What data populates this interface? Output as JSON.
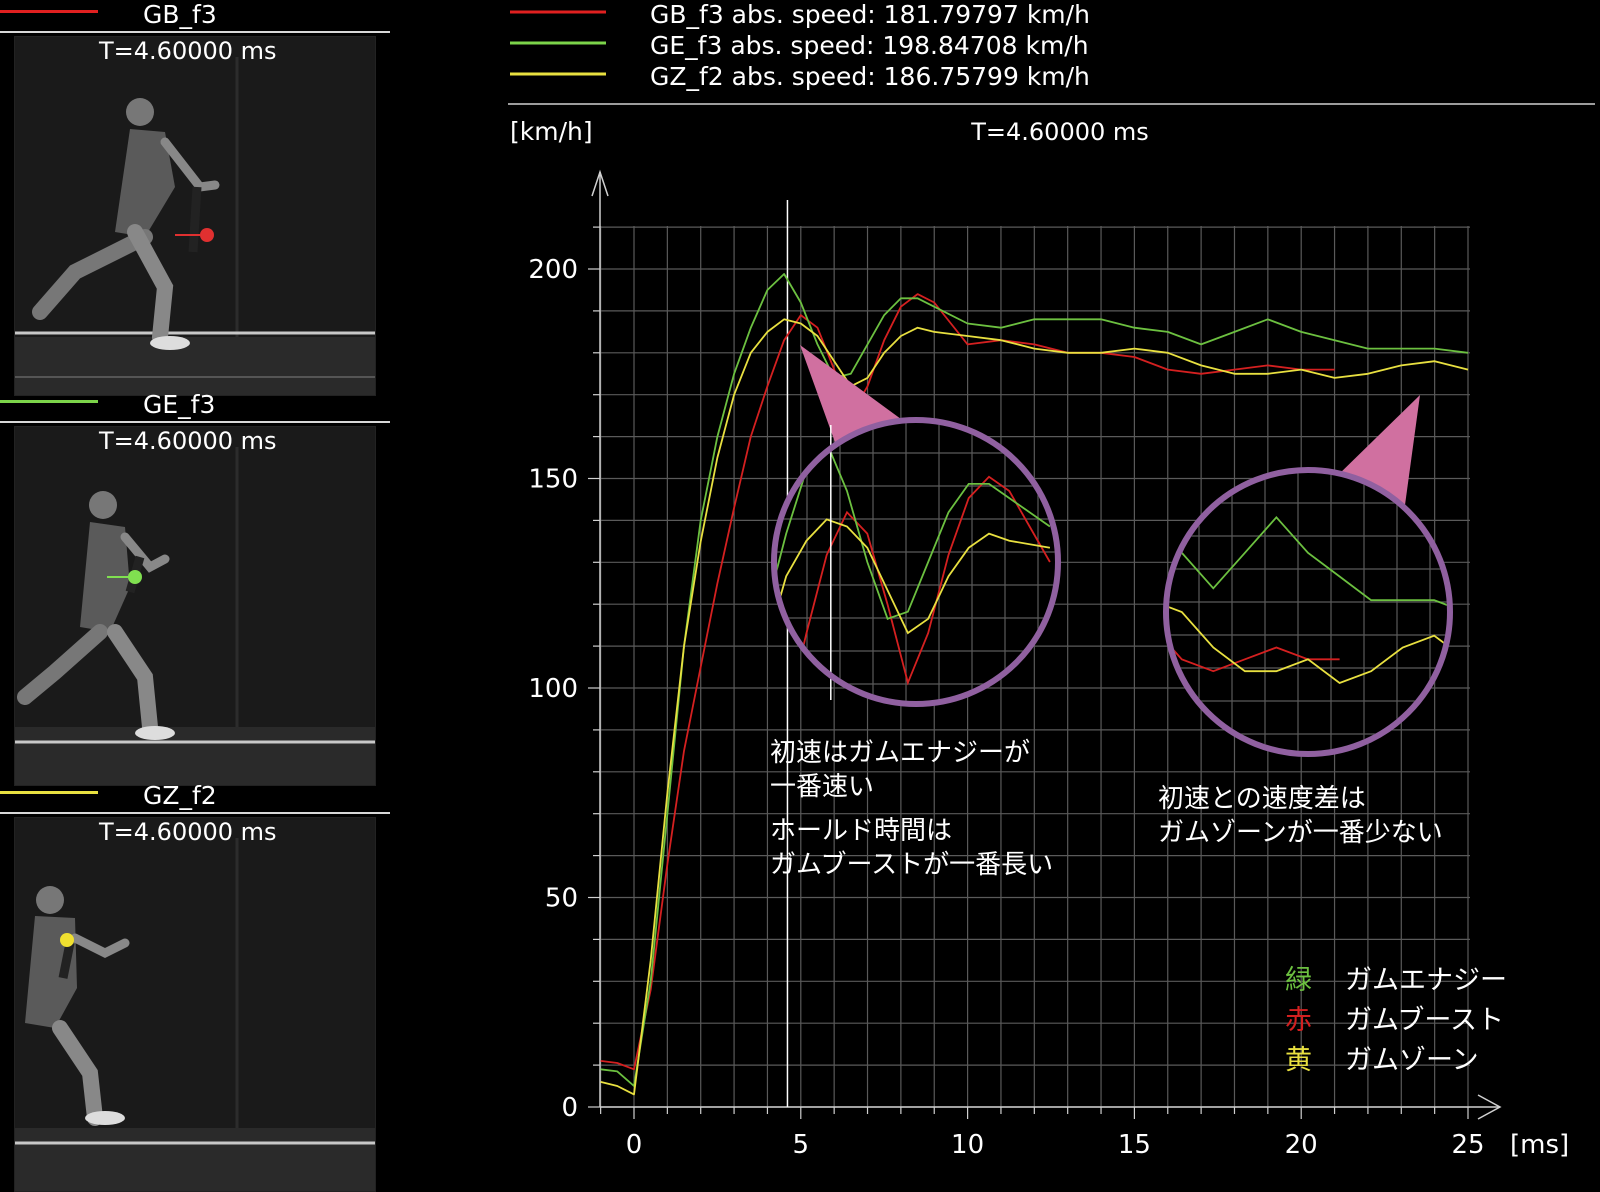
{
  "panels": [
    {
      "label": "GB_f3",
      "color": "#e02020",
      "time": "T=4.60000 ms",
      "ball_color": "#e03030"
    },
    {
      "label": "GE_f3",
      "color": "#7cd44a",
      "time": "T=4.60000 ms",
      "ball_color": "#80e050"
    },
    {
      "label": "GZ_f2",
      "color": "#e8e040",
      "time": "T=4.60000 ms",
      "ball_color": "#f0e030"
    }
  ],
  "header_legend": [
    {
      "text": "GB_f3 abs. speed: 181.79797 km/h",
      "color": "#e02020"
    },
    {
      "text": "GE_f3 abs. speed: 198.84708 km/h",
      "color": "#7cd44a"
    },
    {
      "text": "GZ_f2 abs. speed: 186.75799 km/h",
      "color": "#e8e040"
    }
  ],
  "chart_data": {
    "type": "line",
    "ylabel": "[km/h]",
    "xlabel": "[ms]",
    "time_label": "T=4.60000 ms",
    "cursor_x": 4.6,
    "xlim": [
      -1,
      25
    ],
    "ylim": [
      0,
      215
    ],
    "xticks": [
      0,
      5,
      10,
      15,
      20,
      25
    ],
    "yticks": [
      0,
      50,
      100,
      150,
      200
    ],
    "grid": true,
    "series": [
      {
        "name": "GB_f3",
        "color": "#d42020",
        "x": [
          -1,
          -0.5,
          0,
          0.5,
          1,
          1.5,
          2,
          2.5,
          3,
          3.5,
          4,
          4.5,
          5,
          5.5,
          6,
          6.5,
          7,
          7.5,
          8,
          8.5,
          9,
          9.5,
          10,
          11,
          12,
          13,
          14,
          15,
          16,
          17,
          18,
          19,
          20,
          20.5,
          21
        ],
        "y": [
          11,
          10.5,
          9,
          28,
          58,
          85,
          105,
          125,
          143,
          160,
          172,
          183,
          189,
          186,
          176,
          165,
          172,
          183,
          191,
          194,
          192,
          187,
          182,
          183,
          182,
          180,
          180,
          179,
          176,
          175,
          176,
          177,
          176,
          176,
          176
        ]
      },
      {
        "name": "GE_f3",
        "color": "#6cc040",
        "x": [
          -1,
          -0.5,
          0,
          0.5,
          1,
          1.5,
          2,
          2.5,
          3,
          3.5,
          4,
          4.5,
          5,
          5.5,
          6,
          6.5,
          7,
          7.5,
          8,
          8.5,
          9,
          10,
          11,
          12,
          13,
          14,
          15,
          16,
          17,
          18,
          19,
          20,
          21,
          22,
          23,
          24,
          25
        ],
        "y": [
          9,
          8.5,
          5,
          30,
          70,
          110,
          140,
          160,
          175,
          186,
          195,
          198.8,
          192,
          182,
          174,
          175,
          182,
          189,
          193,
          193,
          191,
          187,
          186,
          188,
          188,
          188,
          186,
          185,
          182,
          185,
          188,
          185,
          183,
          181,
          181,
          181,
          180
        ]
      },
      {
        "name": "GZ_f2",
        "color": "#e8e040",
        "x": [
          -1,
          -0.5,
          0,
          0.5,
          1,
          1.5,
          2,
          2.5,
          3,
          3.5,
          4,
          4.5,
          5,
          5.5,
          6,
          6.5,
          7,
          7.5,
          8,
          8.5,
          9,
          10,
          11,
          12,
          13,
          14,
          15,
          16,
          17,
          18,
          19,
          20,
          21,
          22,
          23,
          24,
          25
        ],
        "y": [
          6,
          5,
          3,
          35,
          75,
          110,
          135,
          155,
          170,
          180,
          185,
          188,
          187,
          184,
          178,
          172,
          174,
          180,
          184,
          186,
          185,
          184,
          183,
          181,
          180,
          180,
          181,
          180,
          177,
          175,
          175,
          176,
          174,
          175,
          177,
          178,
          176
        ]
      }
    ],
    "annotations": [
      {
        "lines": [
          "初速はガムエナジーが",
          "一番速い"
        ]
      },
      {
        "lines": [
          "ホールド時間は",
          "ガムブーストが一番長い"
        ]
      },
      {
        "lines": [
          "初速との速度差は",
          "ガムゾーンが一番少ない"
        ]
      }
    ],
    "legend": [
      {
        "mark": "緑",
        "label": "ガムエナジー",
        "color": "#6cc040"
      },
      {
        "mark": "赤",
        "label": "ガムブースト",
        "color": "#d42020"
      },
      {
        "mark": "黄",
        "label": "ガムゾーン",
        "color": "#e8e040"
      }
    ],
    "callout_color": "#d070a0",
    "circle_color": "#9060a0"
  }
}
